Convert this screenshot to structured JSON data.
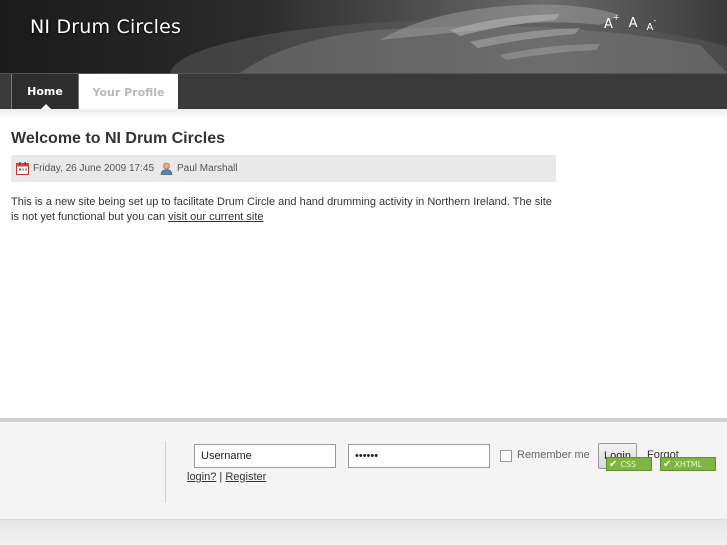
{
  "header": {
    "site_title": "NI Drum Circles",
    "font_tools": {
      "increase": "A",
      "reset": "A",
      "decrease": "A",
      "plus": "+",
      "minus": "-"
    }
  },
  "nav": {
    "tabs": [
      {
        "label": "Home",
        "active": true
      },
      {
        "label": "Your Profile",
        "active": false
      }
    ]
  },
  "article": {
    "title": "Welcome to NI Drum Circles",
    "date": "Friday, 26 June 2009 17:45",
    "author": "Paul Marshall",
    "body_text": "This is a new site being set up to facilitate Drum Circle and hand drumming activity in Northern Ireland. The site is not yet functional but you can",
    "body_link": "visit our current site",
    "icons": {
      "date": "calendar-icon",
      "author": "user-icon"
    }
  },
  "login": {
    "username_value": "Username",
    "password_value": "••••••",
    "remember_label": "Remember me",
    "remember_checked": false,
    "login_button": "Login",
    "forgot_prefix": "Forgot",
    "forgot_link": "login?",
    "separator": "|",
    "register_link": "Register"
  },
  "badges": {
    "css": "CSS",
    "xhtml": "XHTML",
    "check_icon": "check-icon"
  },
  "colors": {
    "header_dark": "#2b2b2b",
    "nav_bg": "#3a3a3a",
    "meta_bg": "#e9e9e9",
    "badge_green": "#7fb543"
  }
}
